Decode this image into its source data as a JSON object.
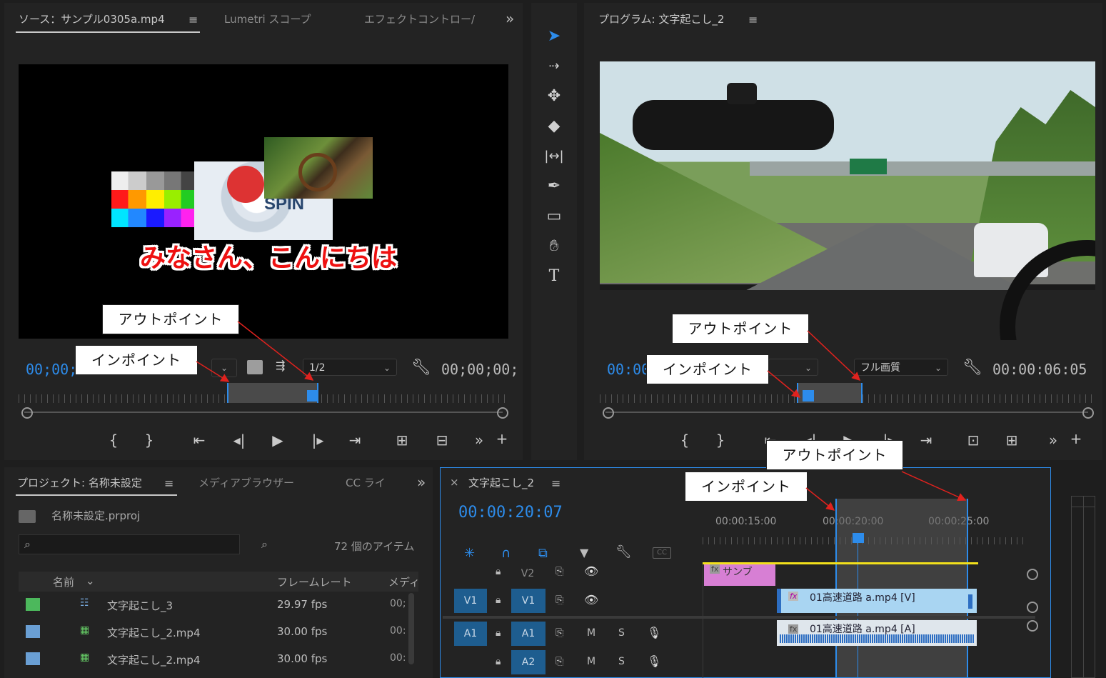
{
  "source_panel": {
    "tabs": [
      "ソース：サンプル0305a.mp4",
      "Lumetri スコープ",
      "エフェクトコントロー/"
    ],
    "tab_more": "»",
    "video_title_text": "みなさん、こんにちは",
    "video_spin_text": "SPIN",
    "timecode_left": "00;00;0",
    "resolution": "1/2",
    "timecode_right": "00;00;00;",
    "callout_out": "アウトポイント",
    "callout_in": "インポイント"
  },
  "program_panel": {
    "title": "プログラム: 文字起こし_2",
    "timecode_left": "00:00",
    "quality": "フル画質",
    "timecode_right": "00:00:06:05",
    "callout_out": "アウトポイント",
    "callout_in": "インポイント"
  },
  "tools": [
    "selection-tool",
    "track-select-tool",
    "ripple-edit-tool",
    "razor-tool",
    "slip-tool",
    "pen-tool",
    "rectangle-tool",
    "hand-tool",
    "type-tool"
  ],
  "project_panel": {
    "tabs": [
      "プロジェクト: 名称未設定",
      "メディアブラウザー",
      "CC ライ"
    ],
    "tab_more": "»",
    "project_file": "名称未設定.prproj",
    "item_count": "72 個のアイテム",
    "columns": [
      "名前",
      "フレームレート",
      "メディ"
    ],
    "rows": [
      {
        "name": "文字起こし_3",
        "fps": "29.97 fps",
        "media": "00;",
        "color": "#4cb85c",
        "kind": "sequence"
      },
      {
        "name": "文字起こし_2.mp4",
        "fps": "30.00 fps",
        "media": "00:",
        "color": "#6a9fd4",
        "kind": "clip"
      },
      {
        "name": "文字起こし_2.mp4",
        "fps": "30.00 fps",
        "media": "00:",
        "color": "#6a9fd4",
        "kind": "clip"
      }
    ]
  },
  "timeline_panel": {
    "close": "×",
    "title": "文字起こし_2",
    "timecode": "00:00:20:07",
    "ruler_labels": [
      "00:00:15:00",
      "00:00:20:00",
      "00:00:25:00"
    ],
    "callout_out": "アウトポイント",
    "callout_in": "インポイント",
    "tracks": {
      "v2": {
        "label": "V2"
      },
      "v1": {
        "source": "V1",
        "label": "V1"
      },
      "a1": {
        "source": "A1",
        "label": "A1",
        "m": "M",
        "s": "S"
      },
      "a2": {
        "label": "A2",
        "m": "M",
        "s": "S"
      }
    },
    "clips": {
      "v2_clip": "サンブ",
      "v1_clip": "01高速道路 a.mp4 [V]",
      "a1_clip": "01高速道路 a.mp4 [A]"
    },
    "fx": "fx"
  },
  "colors": {
    "accent_blue": "#2d8ceb",
    "callout_arrow": "#e0221e",
    "clip_video": "#a9d5f2",
    "clip_pink": "#d77fd4",
    "track_blue": "#1e5d8f"
  }
}
